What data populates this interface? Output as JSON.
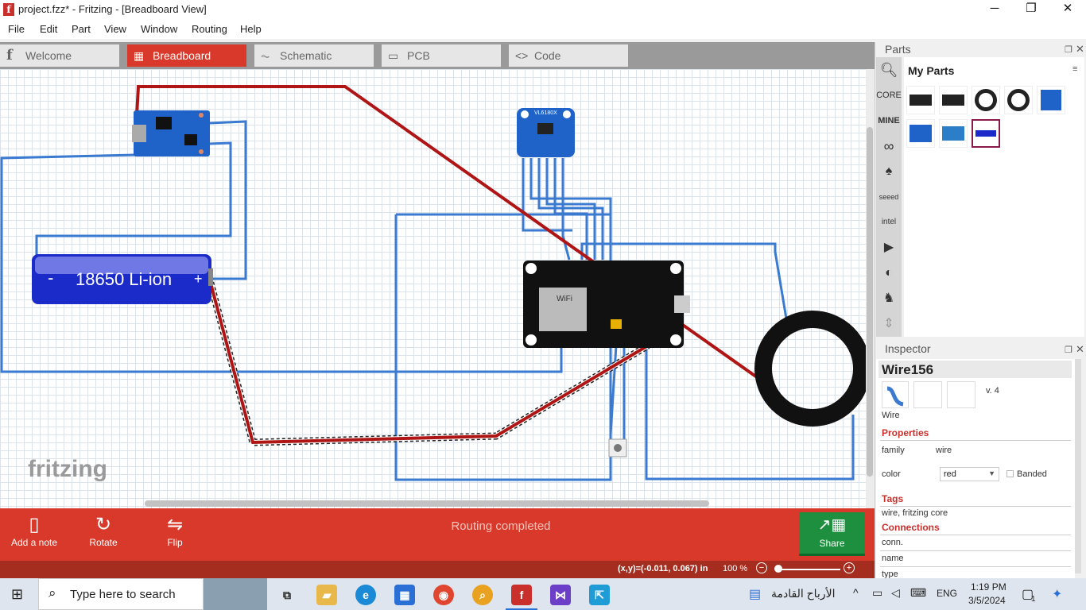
{
  "window": {
    "title": "project.fzz* - Fritzing - [Breadboard View]",
    "minimize_glyph": "─",
    "maximize_glyph": "❐",
    "close_glyph": "✕"
  },
  "menu": [
    "File",
    "Edit",
    "Part",
    "View",
    "Window",
    "Routing",
    "Help"
  ],
  "tabs": [
    {
      "label": "Welcome",
      "icon": "fritzing-icon"
    },
    {
      "label": "Breadboard",
      "icon": "breadboard-icon",
      "active": true
    },
    {
      "label": "Schematic",
      "icon": "schematic-icon"
    },
    {
      "label": "PCB",
      "icon": "pcb-icon"
    },
    {
      "label": "Code",
      "icon": "code-icon"
    }
  ],
  "canvas": {
    "battery_label": "18650 Li-ion",
    "battery_minus": "-",
    "battery_plus": "+",
    "sensor_label": "VL6180X",
    "board_label": "WiFi",
    "watermark": "fritzing"
  },
  "toolbar": {
    "add_note": "Add a note",
    "rotate": "Rotate",
    "flip": "Flip",
    "share": "Share",
    "routing_status": "Routing completed"
  },
  "status": {
    "coordinates": "(x,y)=(-0.011, 0.067) in",
    "zoom": "100 %",
    "zoom_out": "−",
    "zoom_in": "+"
  },
  "parts_panel": {
    "title": "Parts",
    "my_parts": "My Parts",
    "bins": [
      "CORE",
      "MINE",
      "seeed",
      "intel"
    ]
  },
  "inspector": {
    "title": "Inspector",
    "part_name": "Wire156",
    "version": "v. 4",
    "part_type": "Wire",
    "properties_heading": "Properties",
    "family_label": "family",
    "family_value": "wire",
    "color_label": "color",
    "color_value": "red",
    "banded_label": "Banded",
    "tags_heading": "Tags",
    "tags_value": "wire, fritzing core",
    "connections_heading": "Connections",
    "conn_label": "conn.",
    "name_label": "name",
    "type_label": "type"
  },
  "taskbar": {
    "search_placeholder": "Type here to search",
    "weather_text": "الأرباح القادمة",
    "language": "ENG",
    "time": "1:19 PM",
    "date": "3/5/2024",
    "notification_count": "1"
  },
  "colors": {
    "accent": "#d8392a",
    "wire_red": "#b01515",
    "wire_blue": "#3a7ad0",
    "share_green": "#1e8f3e"
  }
}
